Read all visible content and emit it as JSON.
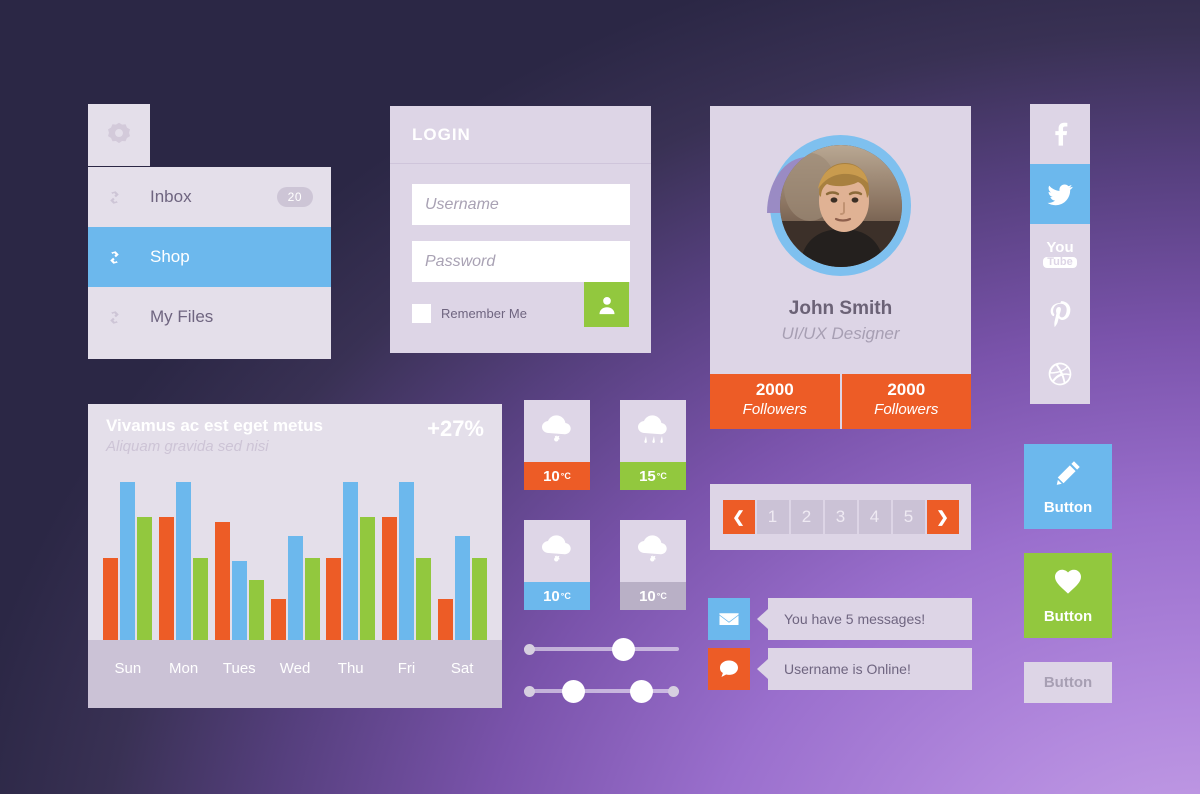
{
  "theme": {
    "blue": "#6cb8ed",
    "orange": "#ed5c26",
    "green": "#92c83e",
    "panel": "#ddd5e6",
    "panel_alt": "#e4dfea",
    "gray": "#cbc2d6",
    "bg_dark": "#2b2745",
    "bg_light": "#ac86dc"
  },
  "menu": {
    "gear_icon": "gear-icon",
    "items": [
      {
        "label": "Inbox",
        "icon": "link-icon",
        "badge": "20",
        "active": false
      },
      {
        "label": "Shop",
        "icon": "link-icon",
        "badge": "",
        "active": true
      },
      {
        "label": "My Files",
        "icon": "link-icon",
        "badge": "",
        "active": false
      }
    ]
  },
  "login": {
    "title": "LOGIN",
    "username_placeholder": "Username",
    "username_value": "",
    "password_placeholder": "Password",
    "password_value": "",
    "remember_label": "Remember Me",
    "remember_checked": false,
    "submit_icon": "user-icon"
  },
  "profile": {
    "name": "John Smith",
    "role": "UI/UX Designer",
    "avatar_icon": "avatar-photo",
    "stats": [
      {
        "number": "2000",
        "label": "Followers"
      },
      {
        "number": "2000",
        "label": "Followers"
      }
    ]
  },
  "chart_data": {
    "type": "bar",
    "title": "Vivamus ac est eget metus",
    "subtitle": "Aliquam gravida sed nisi",
    "delta": "+27%",
    "categories": [
      "Sun",
      "Mon",
      "Tues",
      "Wed",
      "Thu",
      "Fri",
      "Sat"
    ],
    "series": [
      {
        "name": "series-1",
        "color": "#ed5c26",
        "values": [
          52,
          78,
          75,
          26,
          52,
          78,
          26
        ]
      },
      {
        "name": "series-2",
        "color": "#6cb8ed",
        "values": [
          100,
          100,
          50,
          66,
          100,
          100,
          66
        ]
      },
      {
        "name": "series-3",
        "color": "#92c83e",
        "values": [
          78,
          52,
          38,
          52,
          78,
          52,
          52
        ]
      }
    ],
    "xlabel": "",
    "ylabel": "",
    "ylim": [
      0,
      100
    ],
    "grid": false,
    "legend": "none"
  },
  "weather": [
    {
      "icon": "cloud-snow-icon",
      "temp": "10",
      "unit": "°C",
      "color": "#ed5c26"
    },
    {
      "icon": "cloud-rain-icon",
      "temp": "15",
      "unit": "°C",
      "color": "#92c83e"
    },
    {
      "icon": "cloud-snow-icon",
      "temp": "10",
      "unit": "°C",
      "color": "#6cb8ed"
    },
    {
      "icon": "cloud-snow-icon",
      "temp": "10",
      "unit": "°C",
      "color": "#b9b0c6"
    }
  ],
  "sliders": [
    {
      "name": "single-slider",
      "handles": [
        65
      ]
    },
    {
      "name": "range-slider",
      "handles": [
        30,
        75
      ]
    }
  ],
  "pager": {
    "prev_icon": "chevron-left-icon",
    "next_icon": "chevron-right-icon",
    "pages": [
      "1",
      "2",
      "3",
      "4",
      "5"
    ]
  },
  "notifications": [
    {
      "icon": "mail-icon",
      "color": "#6cb8ed",
      "text": "You have 5 messages!"
    },
    {
      "icon": "chat-bubble-icon",
      "color": "#ed5c26",
      "text": "Username is Online!"
    }
  ],
  "social": [
    {
      "name": "facebook-icon",
      "active": false
    },
    {
      "name": "twitter-icon",
      "active": true
    },
    {
      "name": "youtube-icon",
      "active": false
    },
    {
      "name": "pinterest-icon",
      "active": false
    },
    {
      "name": "dribbble-icon",
      "active": false
    }
  ],
  "buttons": [
    {
      "label": "Button",
      "icon": "pencil-icon",
      "style": "blue"
    },
    {
      "label": "Button",
      "icon": "heart-icon",
      "style": "green"
    },
    {
      "label": "Button",
      "icon": "",
      "style": "plain"
    }
  ]
}
